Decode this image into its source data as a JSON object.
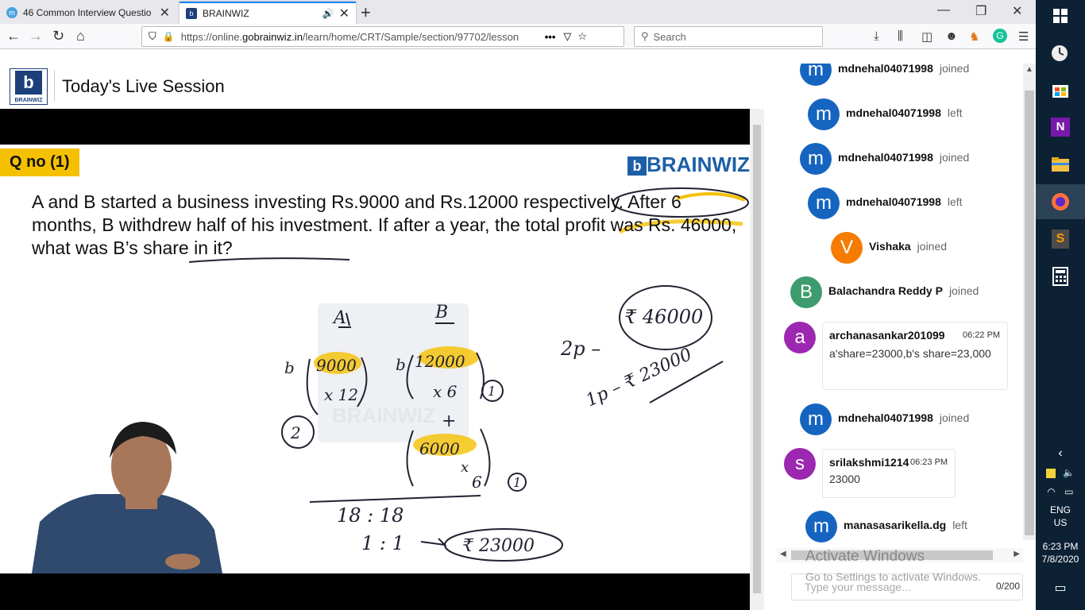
{
  "browser": {
    "tabs": [
      {
        "title": "46 Common Interview Questio",
        "active": false
      },
      {
        "title": "BRAINWIZ",
        "active": true
      }
    ],
    "url_prefix": "https://online.",
    "url_domain": "gobrainwiz.in",
    "url_path": "/learn/home/CRT/Sample/section/97702/lesson",
    "url_more": "•••",
    "search_placeholder": "Search"
  },
  "page": {
    "logo_text": "BRAINWIZ",
    "title": "Today's Live Session"
  },
  "slide": {
    "qno": "Q no (1)",
    "brand": "BRAINWIZ",
    "question": "A and B started a business investing Rs.9000 and Rs.12000 respectively. After 6 months, B withdrew half of his investment. If after a year, the total profit was Rs. 46000, what was B’s share in it?"
  },
  "chat": {
    "messages": [
      {
        "type": "event",
        "user": "mdnehal04071998",
        "action": "joined",
        "avatar": "m",
        "color": "#1565c0"
      },
      {
        "type": "event",
        "user": "mdnehal04071998",
        "action": "left",
        "avatar": "m",
        "color": "#1565c0"
      },
      {
        "type": "event",
        "user": "mdnehal04071998",
        "action": "joined",
        "avatar": "m",
        "color": "#1565c0"
      },
      {
        "type": "event",
        "user": "mdnehal04071998",
        "action": "left",
        "avatar": "m",
        "color": "#1565c0"
      },
      {
        "type": "event",
        "user": "Vishaka",
        "action": "joined",
        "avatar": "V",
        "color": "#f57c00"
      },
      {
        "type": "event",
        "user": "Balachandra Reddy P",
        "action": "joined",
        "avatar": "B",
        "color": "#3e9b6e"
      },
      {
        "type": "text",
        "user": "archanasankar201099",
        "time": "06:22 PM",
        "text": "a'share=23000,b's share=23,000",
        "avatar": "a",
        "color": "#9c27b0"
      },
      {
        "type": "event",
        "user": "mdnehal04071998",
        "action": "joined",
        "avatar": "m",
        "color": "#1565c0"
      },
      {
        "type": "text",
        "user": "srilakshmi1214",
        "time": "06:23 PM",
        "text": "23000",
        "avatar": "s",
        "color": "#9c27b0"
      },
      {
        "type": "event",
        "user": "manasasarikella.dg",
        "action": "left",
        "avatar": "m",
        "color": "#1565c0"
      }
    ],
    "input_placeholder": "Type your message...",
    "counter": "0/200"
  },
  "watermark": {
    "line1": "Activate Windows",
    "line2": "Go to Settings to activate Windows."
  },
  "taskbar": {
    "lang": "ENG",
    "region": "US",
    "time": "6:23 PM",
    "date": "7/8/2020"
  }
}
